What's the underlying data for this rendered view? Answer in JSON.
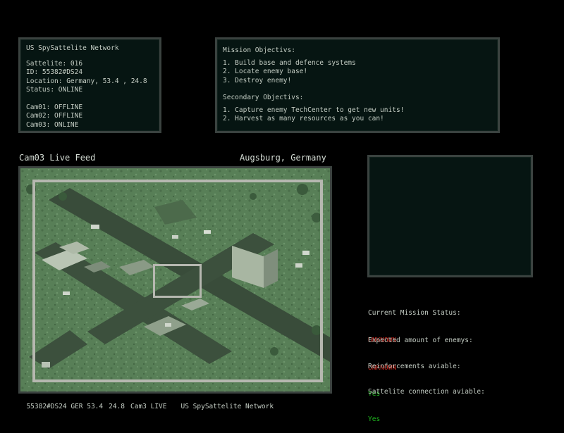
{
  "satellite_panel": {
    "network": "US SpySattelite Network",
    "satellite": "Sattelite: 016",
    "id": "ID: 55382#DS24",
    "location": "Location: Germany, 53.4 , 24.8",
    "status": "Status: ONLINE",
    "cams": [
      "Cam01: OFFLINE",
      "Cam02: OFFLINE",
      "Cam03: ONLINE"
    ]
  },
  "objectives_panel": {
    "title": "Mission Objectivs:",
    "items": [
      "1. Build base and defence systems",
      "2. Locate enemy base!",
      "3. Destroy enemy!"
    ],
    "secondary_title": "Secondary Objectivs:",
    "secondary_items": [
      "1. Capture enemy TechCenter to get new units!",
      "2. Harvest as many resources as you can!"
    ]
  },
  "feed": {
    "title": "Cam03 Live Feed",
    "location": "Augsburg, Germany"
  },
  "status_bar": {
    "id": "55382#DS24 GER 53.4",
    "x": "24.8",
    "cam": "Cam3 LIVE",
    "network": "US SpySattelite Network"
  },
  "mission_info": {
    "mission_status_label": "Current Mission Status:",
    "mission_status_value": "UNKNOWN",
    "enemies_label": "Expected amount of enemys:",
    "enemies_value": "UNKNOWN",
    "reinforcements_label": "Reinforcements aviable:",
    "reinforcements_value": "Yes",
    "connection_label": "Sattelite connection aviable:",
    "connection_value": "Yes"
  },
  "colors": {
    "panel_bg": "#061512",
    "panel_border": "#3a423f",
    "unknown": "#c8281e",
    "yes": "#1fb81f",
    "night_vision": "#6f9a6e"
  }
}
